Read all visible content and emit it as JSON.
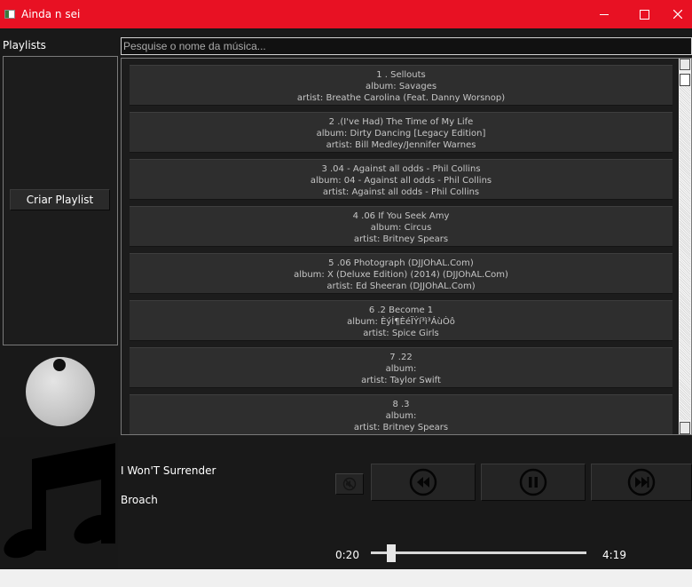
{
  "window": {
    "title": "Ainda n sei",
    "accent_color": "#e81123"
  },
  "sidebar": {
    "playlists_label": "Playlists",
    "create_playlist_label": "Criar Playlist"
  },
  "search": {
    "placeholder": "Pesquise o nome da música..."
  },
  "songs": [
    {
      "title": "1 . Sellouts",
      "album": "album: Savages",
      "artist": "artist: Breathe Carolina  (Feat. Danny Worsnop)"
    },
    {
      "title": "2 .(I've Had) The Time of My Life",
      "album": "album: Dirty Dancing [Legacy Edition]",
      "artist": "artist: Bill Medley/Jennifer Warnes"
    },
    {
      "title": "3 .04 - Against all odds - Phil Collins",
      "album": "album: 04 - Against all odds - Phil Collins",
      "artist": "artist: Against all odds - Phil Collins"
    },
    {
      "title": "4 .06 If You Seek Amy",
      "album": "album: Circus",
      "artist": "artist: Britney Spears"
    },
    {
      "title": "5 .06 Photograph (DJJOhAL.Com)",
      "album": "album: X (Deluxe Edition) (2014) (DJJOhAL.Com)",
      "artist": "artist: Ed Sheeran (DJJOhAL.Com)"
    },
    {
      "title": "6 .2 Become 1",
      "album": "album: ÈýÍ¶ÈéÏÝí³ì³ÁùÒô",
      "artist": "artist: Spice Girls"
    },
    {
      "title": "7 .22",
      "album": "album:",
      "artist": "artist: Taylor Swift"
    },
    {
      "title": "8 .3",
      "album": "album:",
      "artist": "artist: Britney Spears"
    }
  ],
  "now_playing": {
    "title": "I Won'T Surrender",
    "artist": "Broach",
    "current_time": "0:20",
    "total_time": "4:19",
    "progress_fraction": 0.077
  },
  "icons": {
    "volume": "mute-icon",
    "previous": "rewind-icon",
    "play_pause": "pause-icon",
    "next": "fast-forward-icon",
    "cover": "music-note-icon"
  }
}
